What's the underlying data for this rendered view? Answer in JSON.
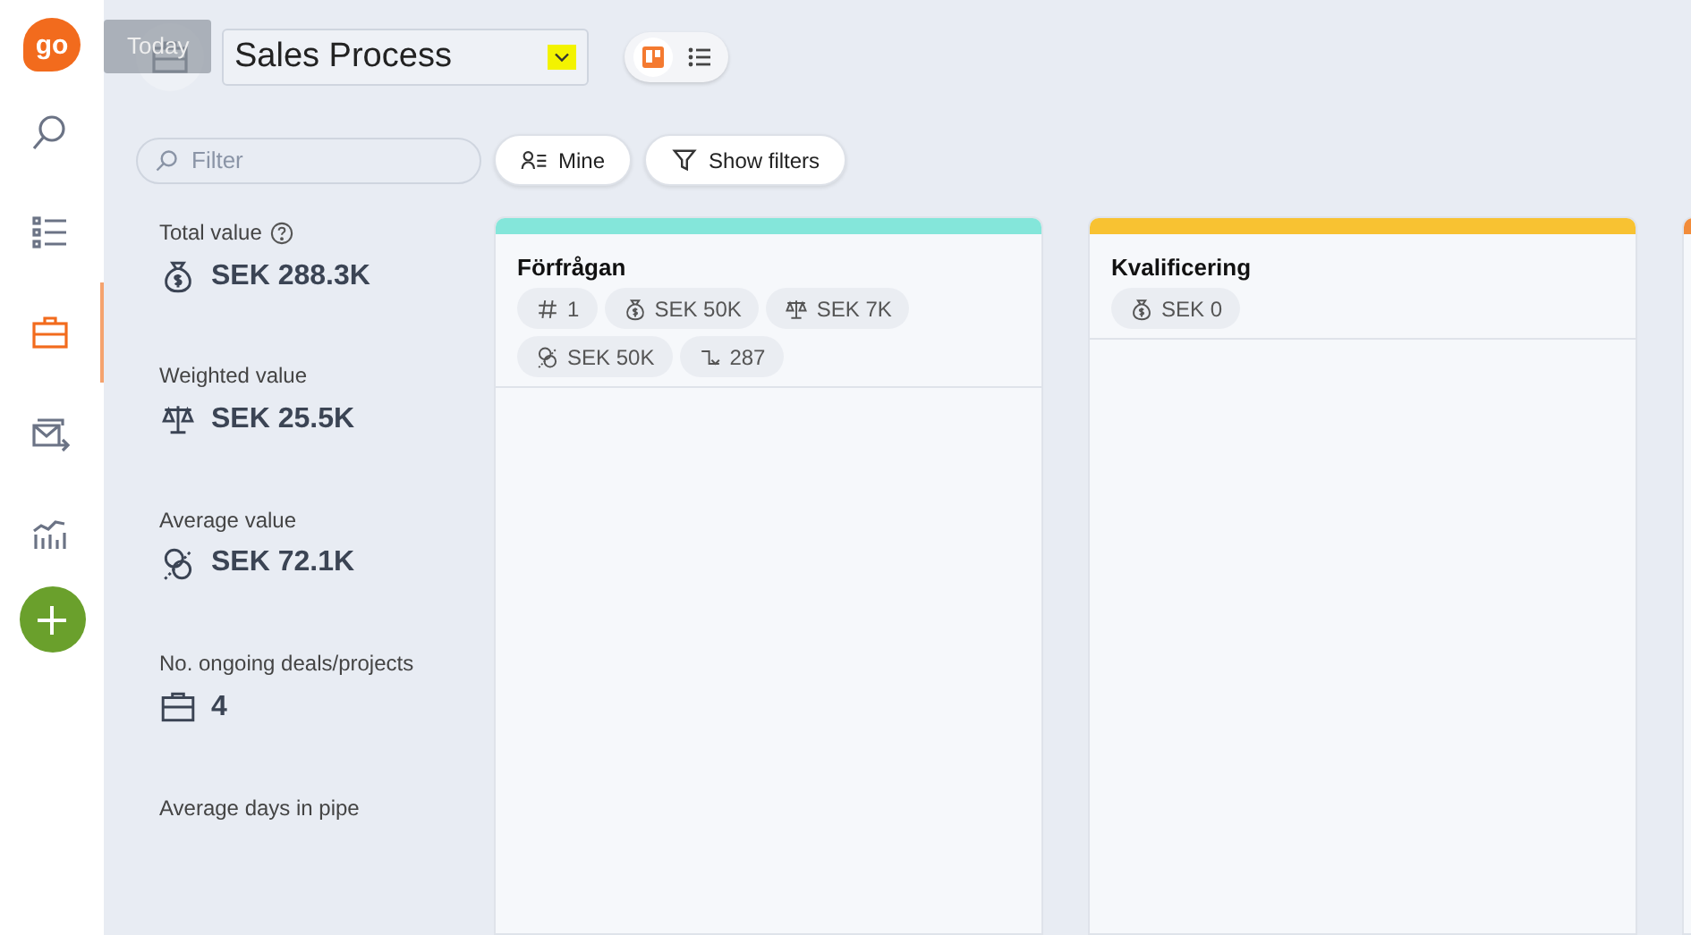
{
  "nav": {
    "items": [
      {
        "kind": "search",
        "selected": false
      },
      {
        "kind": "list",
        "selected": false
      },
      {
        "kind": "briefcase",
        "selected": true
      },
      {
        "kind": "mail",
        "selected": false
      },
      {
        "kind": "chart",
        "selected": false
      }
    ],
    "logo": "go"
  },
  "header": {
    "tooltip": "Today",
    "pipeline": "Sales Process",
    "views": [
      {
        "kind": "board",
        "selected": true
      },
      {
        "kind": "list",
        "selected": false
      }
    ]
  },
  "toolbar": {
    "filter_placeholder": "Filter",
    "buttons": [
      {
        "kind": "mine",
        "label": "Mine"
      },
      {
        "kind": "filters",
        "label": "Show filters"
      }
    ]
  },
  "stats": [
    {
      "kind": "value",
      "label": "Total value",
      "help": true,
      "value": "SEK 288.3K"
    },
    {
      "kind": "weighted",
      "label": "Weighted value",
      "help": false,
      "value": "SEK 25.5K"
    },
    {
      "kind": "average",
      "label": "Average value",
      "help": false,
      "value": "SEK 72.1K"
    },
    {
      "kind": "count",
      "label": "No. ongoing deals/projects",
      "help": false,
      "value": "4"
    },
    {
      "label": "Average days in pipe",
      "help": false
    }
  ],
  "columns": [
    {
      "title": "Förfrågan",
      "color": "#84e6da",
      "chips": [
        {
          "kind": "count",
          "text": "1"
        },
        {
          "kind": "value",
          "text": "SEK 50K"
        },
        {
          "kind": "weighted",
          "text": "SEK 7K"
        },
        {
          "kind": "average",
          "text": "SEK 50K"
        },
        {
          "kind": "days",
          "text": "287"
        }
      ]
    },
    {
      "title": "Kvalificering",
      "color": "#f8c232",
      "chips": [
        {
          "kind": "value",
          "text": "SEK 0"
        }
      ]
    },
    {
      "color": "#f28c3a"
    }
  ]
}
